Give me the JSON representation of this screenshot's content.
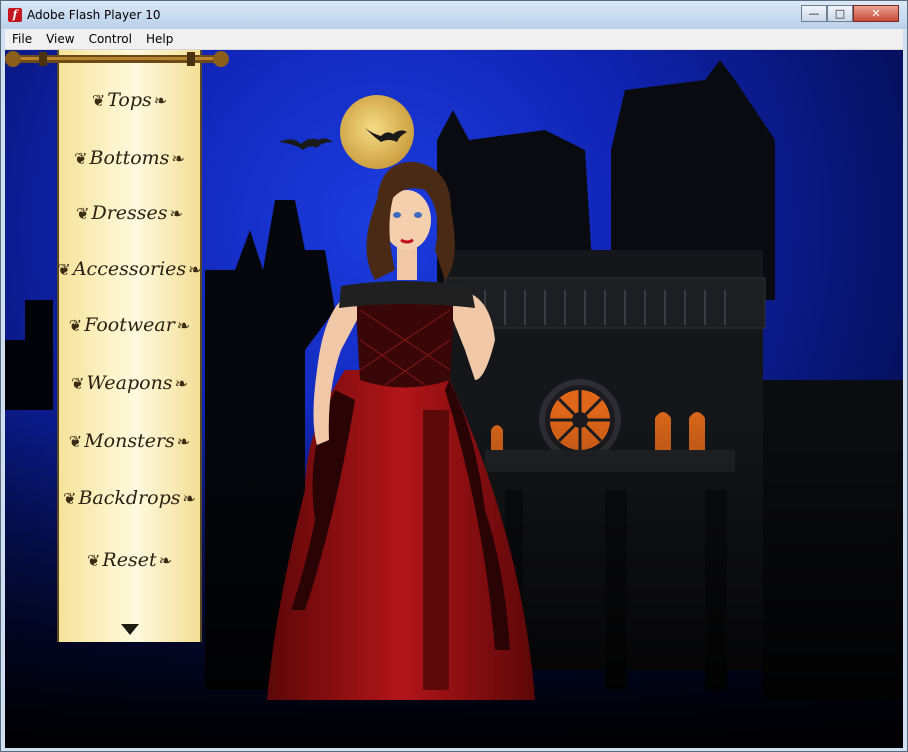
{
  "window": {
    "title": "Adobe Flash Player 10",
    "controls": {
      "minimize": "—",
      "maximize": "□",
      "close": "✕"
    }
  },
  "menubar": {
    "items": [
      "File",
      "View",
      "Control",
      "Help"
    ]
  },
  "game": {
    "categories": [
      "Tops",
      "Bottoms",
      "Dresses",
      "Accessories",
      "Footwear",
      "Weapons",
      "Monsters",
      "Backdrops",
      "Reset"
    ],
    "scroll_icon": "down-arrow-icon",
    "colors": {
      "sky": "#1024b4",
      "moon": "#e9c96a",
      "scroll": "#fdf3c6",
      "dress": "#8e0f12"
    }
  }
}
